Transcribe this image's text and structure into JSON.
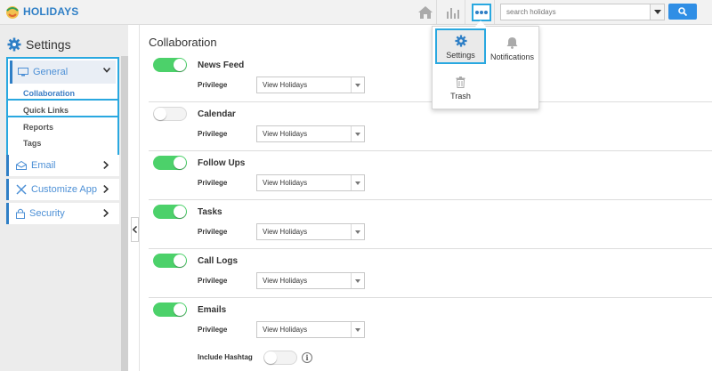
{
  "app": {
    "brand": "HOLIDAYS"
  },
  "topbar": {
    "search_placeholder": "search holidays",
    "icons": [
      "home-icon",
      "chart-icon",
      "more-icon",
      "chevron-down-icon",
      "search-icon"
    ],
    "accent": "#29a8e0"
  },
  "popup": {
    "items": [
      {
        "label": "Settings",
        "icon": "gear-icon"
      },
      {
        "label": "Notifications",
        "icon": "bell-icon"
      },
      {
        "label": "Trash",
        "icon": "trash-icon"
      }
    ]
  },
  "sidebar": {
    "title": "Settings",
    "general": {
      "label": "General",
      "sub_items": [
        "Collaboration",
        "Quick Links",
        "Reports",
        "Tags"
      ]
    },
    "items": [
      {
        "label": "Email",
        "icon": "email-icon"
      },
      {
        "label": "Customize App",
        "icon": "tools-icon"
      },
      {
        "label": "Security",
        "icon": "lock-icon"
      }
    ]
  },
  "main": {
    "title": "Collaboration",
    "privilege_label": "Privilege",
    "features": [
      {
        "name": "News Feed",
        "enabled": true,
        "privilege": "View Holidays"
      },
      {
        "name": "Calendar",
        "enabled": false,
        "privilege": "View Holidays"
      },
      {
        "name": "Follow Ups",
        "enabled": true,
        "privilege": "View Holidays"
      },
      {
        "name": "Tasks",
        "enabled": true,
        "privilege": "View Holidays"
      },
      {
        "name": "Call Logs",
        "enabled": true,
        "privilege": "View Holidays"
      },
      {
        "name": "Emails",
        "enabled": true,
        "privilege": "View Holidays"
      }
    ],
    "include_hashtag": {
      "label": "Include Hashtag",
      "enabled": false,
      "info": "i"
    }
  },
  "colors": {
    "toggle_on": "#4cd16a",
    "brand": "#2f7fc6",
    "primary_button": "#2f8ee5"
  }
}
